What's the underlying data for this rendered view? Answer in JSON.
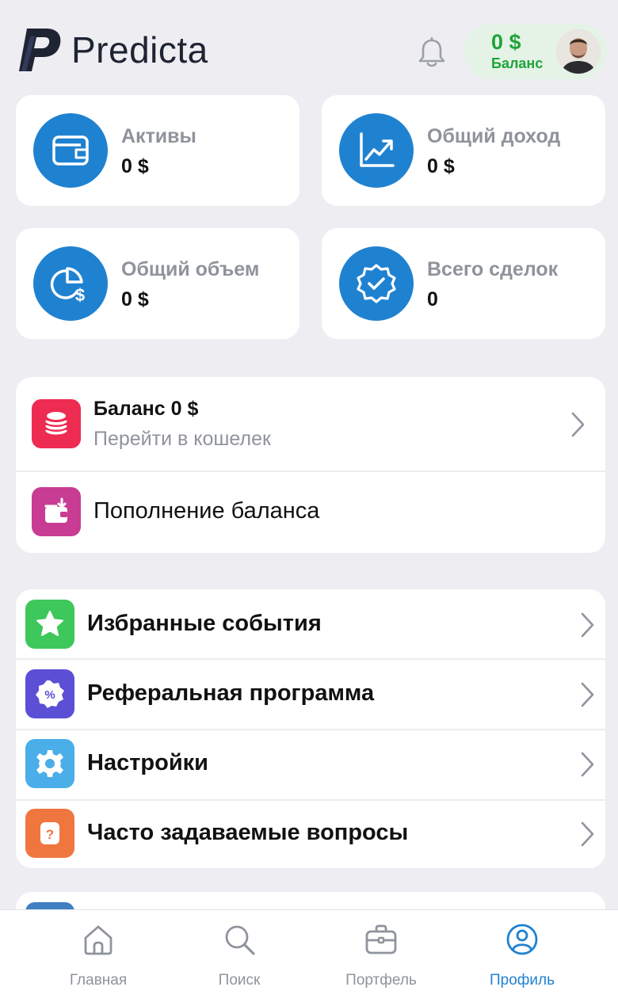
{
  "header": {
    "app_name": "Predicta",
    "balance_amount": "0 $",
    "balance_label": "Баланс"
  },
  "stats": [
    {
      "label": "Активы",
      "value": "0 $",
      "icon": "wallet-icon"
    },
    {
      "label": "Общий доход",
      "value": "0 $",
      "icon": "chart-up-icon"
    },
    {
      "label": "Общий объем",
      "value": "0 $",
      "icon": "pie-dollar-icon"
    },
    {
      "label": "Всего сделок",
      "value": "0",
      "icon": "badge-check-icon"
    }
  ],
  "wallet": {
    "title": "Баланс 0 $",
    "subtitle": "Перейти в кошелек",
    "topup_label": "Пополнение баланса"
  },
  "menu": [
    {
      "label": "Избранные события",
      "icon": "star-icon",
      "color": "#3ec75a"
    },
    {
      "label": "Реферальная программа",
      "icon": "percent-badge-icon",
      "color": "#5b4fd6"
    },
    {
      "label": "Настройки",
      "icon": "gear-icon",
      "color": "#4aaee8"
    },
    {
      "label": "Часто задаваемые вопросы",
      "icon": "question-icon",
      "color": "#f07640"
    }
  ],
  "nav": [
    {
      "label": "Главная",
      "icon": "home-icon"
    },
    {
      "label": "Поиск",
      "icon": "search-icon"
    },
    {
      "label": "Портфель",
      "icon": "briefcase-icon"
    },
    {
      "label": "Профиль",
      "icon": "profile-icon",
      "active": true
    }
  ],
  "colors": {
    "accent": "#1f82d1",
    "balance_green": "#1fa33a",
    "wallet_icon_bg": "#ee2c52",
    "topup_icon_bg": "#c83c93"
  }
}
